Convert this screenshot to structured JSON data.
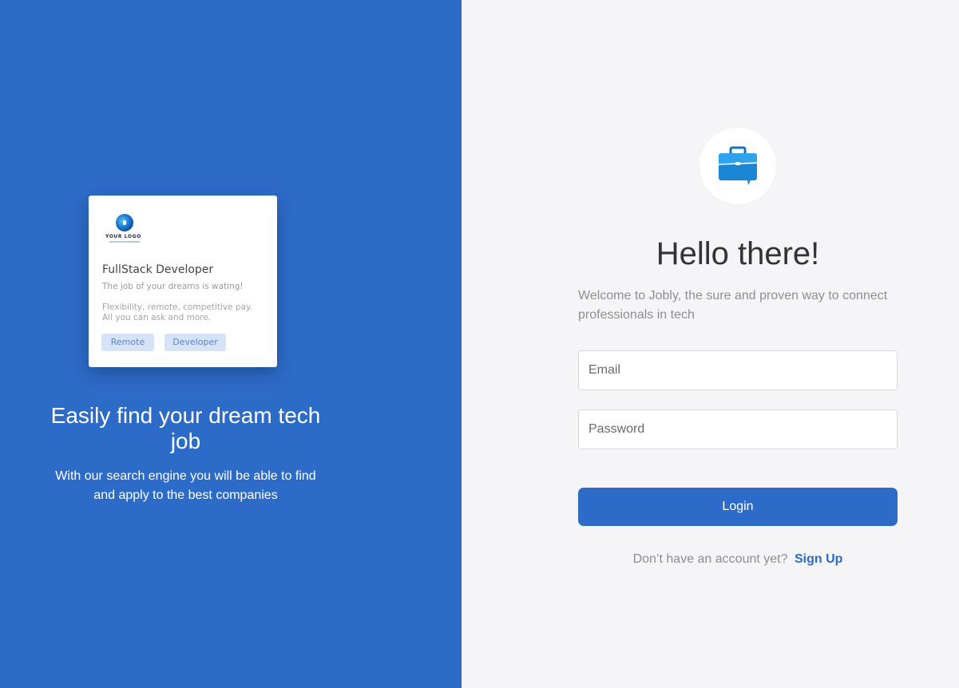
{
  "colors": {
    "brand_blue": "#2d6bc9",
    "panel_bg": "#f5f5f7",
    "tag_bg": "#d6e2f6"
  },
  "job_card": {
    "logo_text": "YOUR LOGO",
    "title": "FullStack Developer",
    "subtitle": "The job of your dreams is wating!",
    "description": "Flexibility, remote, competitive pay. All you can ask and more.",
    "tags": [
      "Remote",
      "Developer"
    ]
  },
  "hero": {
    "title": "Easily find your dream tech job",
    "text": "With our search engine you will be able to find and apply to the best companies"
  },
  "login": {
    "brand_icon": "briefcase-icon",
    "heading": "Hello there!",
    "welcome": "Welcome to Jobly, the sure and proven way to connect professionals in tech",
    "email_placeholder": "Email",
    "password_placeholder": "Password",
    "login_label": "Login",
    "no_account_text": "Don’t have an account yet?",
    "signup_label": "Sign Up"
  }
}
